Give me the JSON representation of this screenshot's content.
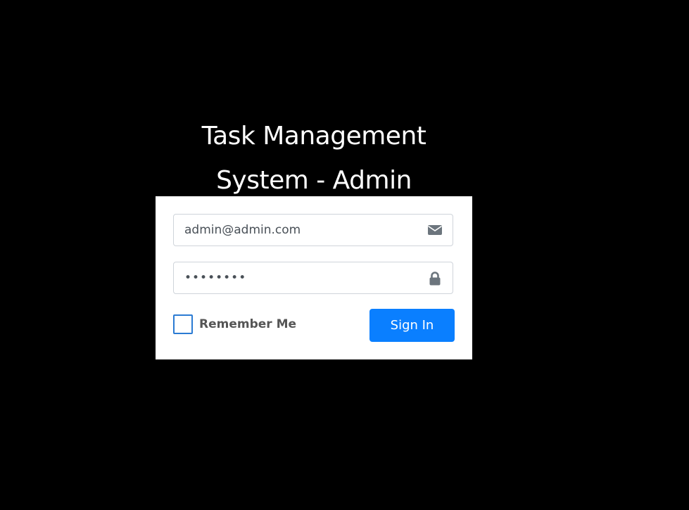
{
  "header": {
    "title_line1": "Task Management",
    "title_line2": "System - Admin"
  },
  "form": {
    "email": {
      "value": "admin@admin.com",
      "icon": "envelope-icon"
    },
    "password": {
      "value": "........",
      "icon": "lock-icon"
    },
    "remember_label": "Remember Me",
    "remember_checked": false,
    "submit_label": "Sign In"
  },
  "colors": {
    "background": "#000000",
    "card": "#ffffff",
    "primary": "#0a7fff",
    "checkbox_border": "#2b7bd3",
    "icon": "#6c757d"
  }
}
